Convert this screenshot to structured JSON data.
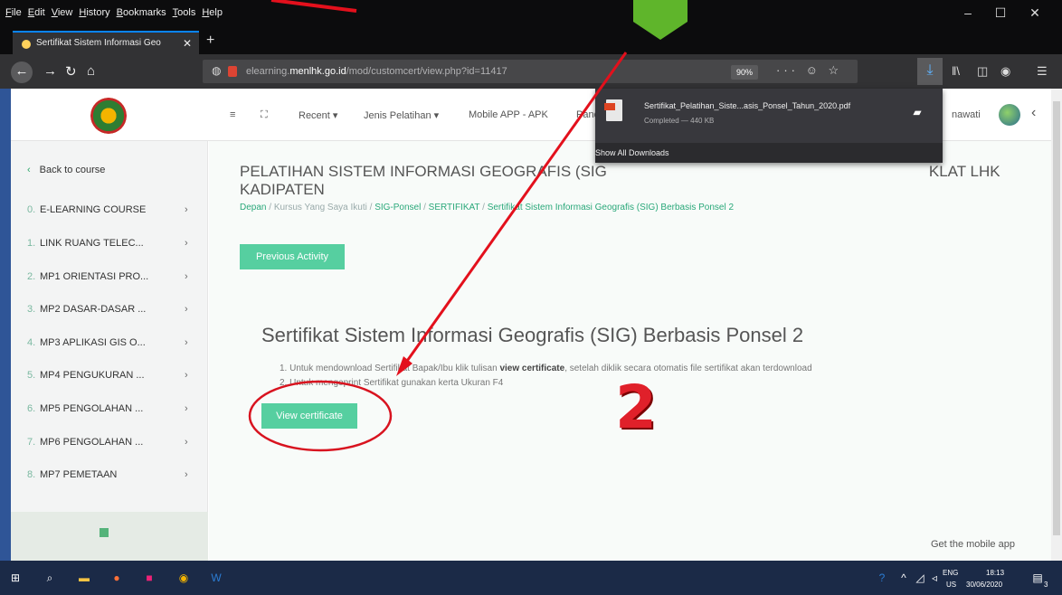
{
  "browser": {
    "menu": [
      "File",
      "Edit",
      "View",
      "History",
      "Bookmarks",
      "Tools",
      "Help"
    ],
    "tab_title": "Sertifikat Sistem Informasi Geo",
    "tab_close": "✕",
    "new_tab": "+",
    "url_prefix": "elearning.",
    "url_domain": "menlhk.go.id",
    "url_path": "/mod/customcert/view.php?id=11417",
    "zoom": "90%",
    "page_actions": "··· ☺ ☆"
  },
  "header": {
    "nav_items": [
      "Recent ▾",
      "Jenis Pelatihan ▾",
      "Mobile APP - APK",
      "Pand"
    ],
    "user_fragment": "nawati"
  },
  "downloads": {
    "file_name": "Sertifikat_Pelatihan_Siste...asis_Ponsel_Tahun_2020.pdf",
    "status": "Completed — 440 KB",
    "show_all": "Show All Downloads"
  },
  "sidebar": {
    "back": "Back to course",
    "items": [
      {
        "num": "0.",
        "label": "E-LEARNING COURSE"
      },
      {
        "num": "1.",
        "label": "LINK RUANG TELEC..."
      },
      {
        "num": "2.",
        "label": "MP1 ORIENTASI PRO..."
      },
      {
        "num": "3.",
        "label": "MP2 DASAR-DASAR ..."
      },
      {
        "num": "4.",
        "label": "MP3 APLIKASI GIS O..."
      },
      {
        "num": "5.",
        "label": "MP4 PENGUKURAN ..."
      },
      {
        "num": "6.",
        "label": "MP5 PENGOLAHAN ..."
      },
      {
        "num": "7.",
        "label": "MP6 PENGOLAHAN ..."
      },
      {
        "num": "8.",
        "label": "MP7 PEMETAAN"
      }
    ]
  },
  "main": {
    "course_title_line1": "PELATIHAN SISTEM INFORMASI GEOGRAFIS (SIG",
    "course_title_line1_end": "KLAT LHK",
    "course_title_line2": "KADIPATEN",
    "breadcrumb": {
      "home": "Depan",
      "my_courses": "Kursus Yang Saya Ikuti",
      "course": "SIG-Ponsel",
      "section": "SERTIFIKAT",
      "current": "Sertifikat Sistem Informasi Geografis (SIG) Berbasis Ponsel 2",
      "sep": " / "
    },
    "prev_button": "Previous Activity",
    "cert_heading": "Sertifikat Sistem Informasi Geografis (SIG) Berbasis Ponsel 2",
    "instruction_1_pre": "1. Untuk mendownload Sertifikat Bapak/Ibu klik tulisan ",
    "instruction_1_bold": "view certificate",
    "instruction_1_post": ", setelah diklik secara otomatis file sertifikat akan terdownload",
    "instruction_2": "2. Untuk mengeprint Sertifikat gunakan kerta Ukuran F4",
    "view_button": "View certificate",
    "mobile_app": "Get the mobile app"
  },
  "annotation": {
    "step_number": "2",
    "arrow_color": "#e3101c",
    "circle_color": "#d8131f"
  },
  "taskbar": {
    "lang": "ENG",
    "region": "US",
    "time": "18:13",
    "date": "30/06/2020",
    "notif_count": "3"
  }
}
